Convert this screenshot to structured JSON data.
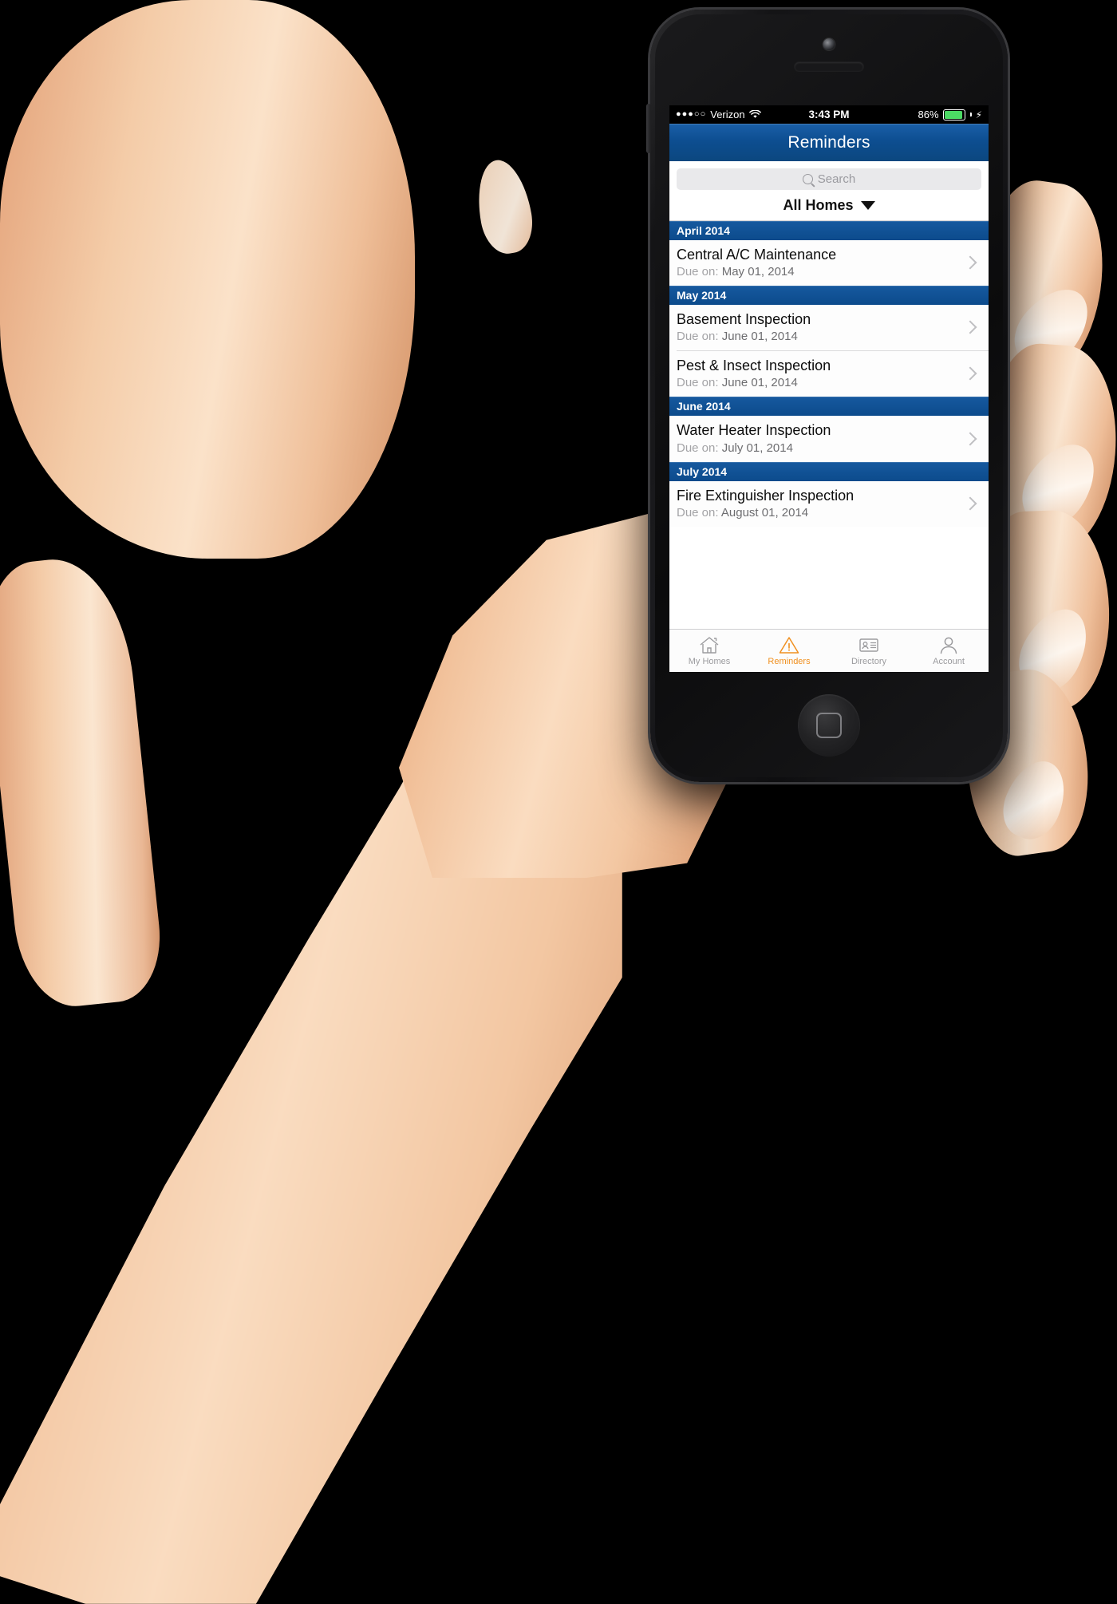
{
  "device": {
    "name": "iphone-5",
    "body_color": "#141416",
    "home_button": "home-button"
  },
  "status_bar": {
    "signal_dots": "●●●○○",
    "carrier": "Verizon",
    "wifi_icon": "wifi-icon",
    "time": "3:43 PM",
    "battery_percent": "86%",
    "battery_level": 86,
    "battery_color": "#4cd964",
    "charging": true
  },
  "nav_bar": {
    "title": "Reminders",
    "background": "#0d4e91"
  },
  "search": {
    "placeholder": "Search",
    "value": "",
    "icon": "search-icon"
  },
  "filter": {
    "label": "All Homes",
    "caret": "chevron-down-icon"
  },
  "list": {
    "sections": [
      {
        "header": "April 2014",
        "items": [
          {
            "title": "Central A/C Maintenance",
            "due_label": "Due on:",
            "due_date": "May 01, 2014"
          }
        ]
      },
      {
        "header": "May 2014",
        "items": [
          {
            "title": "Basement Inspection",
            "due_label": "Due on:",
            "due_date": "June 01, 2014"
          },
          {
            "title": "Pest & Insect Inspection",
            "due_label": "Due on:",
            "due_date": "June 01, 2014"
          }
        ]
      },
      {
        "header": "June 2014",
        "items": [
          {
            "title": "Water Heater Inspection",
            "due_label": "Due on:",
            "due_date": "July 01, 2014"
          }
        ]
      },
      {
        "header": "July 2014",
        "items": [
          {
            "title": "Fire Extinguisher Inspection",
            "due_label": "Due on:",
            "due_date": "August 01, 2014"
          }
        ]
      }
    ]
  },
  "tab_bar": {
    "active_color": "#f09020",
    "inactive_color": "#9b9b9e",
    "tabs": [
      {
        "label": "My Homes",
        "icon": "house-icon",
        "active": false
      },
      {
        "label": "Reminders",
        "icon": "warning-triangle-icon",
        "active": true
      },
      {
        "label": "Directory",
        "icon": "contact-card-icon",
        "active": false
      },
      {
        "label": "Account",
        "icon": "person-icon",
        "active": false
      }
    ]
  }
}
